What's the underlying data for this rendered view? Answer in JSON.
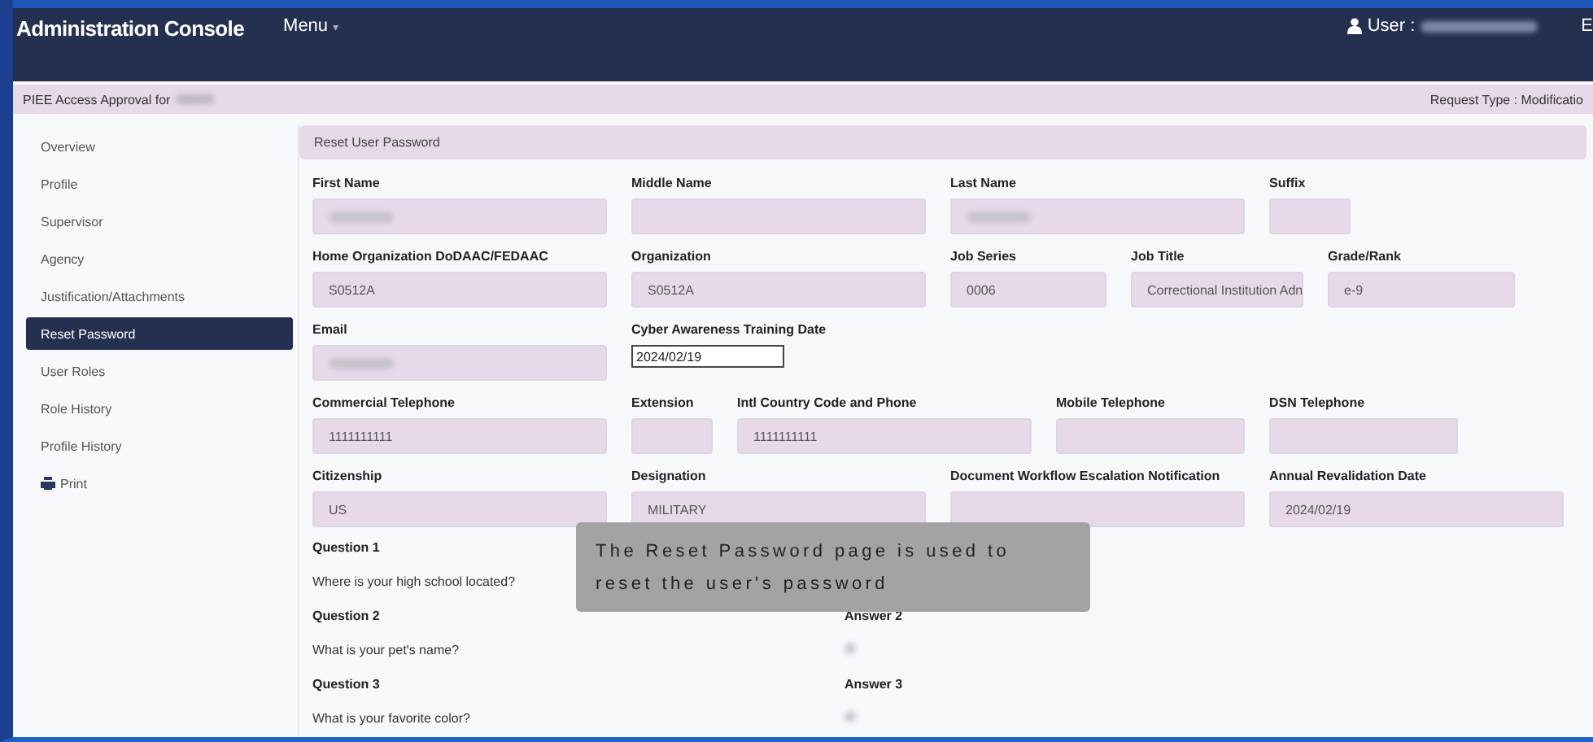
{
  "header": {
    "title": "Administration Console",
    "menu": "Menu",
    "menu_caret": "▾",
    "user_label": "User :",
    "cut_text": "E"
  },
  "request_bar": {
    "left": "PIEE Access Approval for",
    "right": "Request Type : Modificatio"
  },
  "sidebar": {
    "items": [
      {
        "label": "Overview",
        "selected": false
      },
      {
        "label": "Profile",
        "selected": false
      },
      {
        "label": "Supervisor",
        "selected": false
      },
      {
        "label": "Agency",
        "selected": false
      },
      {
        "label": "Justification/Attachments",
        "selected": false
      },
      {
        "label": "Reset Password",
        "selected": true
      },
      {
        "label": "User Roles",
        "selected": false
      },
      {
        "label": "Role History",
        "selected": false
      },
      {
        "label": "Profile History",
        "selected": false
      },
      {
        "label": "Print",
        "selected": false,
        "kind": "print"
      }
    ]
  },
  "panel": {
    "title": "Reset User Password",
    "rows": [
      [
        {
          "label": "First Name",
          "redacted": true
        },
        {
          "label": "Middle Name"
        },
        {
          "label": "Last Name",
          "redacted": true
        },
        {
          "label": "Suffix"
        }
      ],
      [
        {
          "label": "Home Organization DoDAAC/FEDAAC",
          "value": "S0512A"
        },
        {
          "label": "Organization",
          "value": "S0512A"
        },
        {
          "label": "Job Series",
          "value": "0006"
        },
        {
          "label": "Job Title",
          "value": "Correctional Institution Adn"
        },
        {
          "label": "Grade/Rank",
          "value": "e-9"
        }
      ],
      [
        {
          "label": "Email",
          "redacted": true
        },
        {
          "label": "Cyber Awareness Training Date",
          "value": "2024/02/19",
          "kind": "editable"
        }
      ],
      [
        {
          "label": "Commercial Telephone",
          "value": "1111111111"
        },
        {
          "label": "Extension"
        },
        {
          "label": "Intl Country Code and Phone",
          "value": "1111111111"
        },
        {
          "label": "Mobile Telephone"
        },
        {
          "label": "DSN Telephone"
        }
      ],
      [
        {
          "label": "Citizenship",
          "value": "US"
        },
        {
          "label": "Designation",
          "value": "MILITARY"
        },
        {
          "label": "Document Workflow Escalation Notification"
        },
        {
          "label": "Annual Revalidation Date",
          "value": "2024/02/19"
        }
      ]
    ],
    "questions": [
      {
        "label": "Question 1",
        "text": "Where is your high school located?"
      },
      {
        "label": "Question 2",
        "text": "What is your pet's name?",
        "answer_label": "Answer 2",
        "answer_redacted": true
      },
      {
        "label": "Question 3",
        "text": "What is your favorite color?",
        "answer_label": "Answer 3",
        "answer_redacted": true
      }
    ]
  },
  "tooltip": {
    "text": "The Reset Password page is used to reset the user's password"
  }
}
